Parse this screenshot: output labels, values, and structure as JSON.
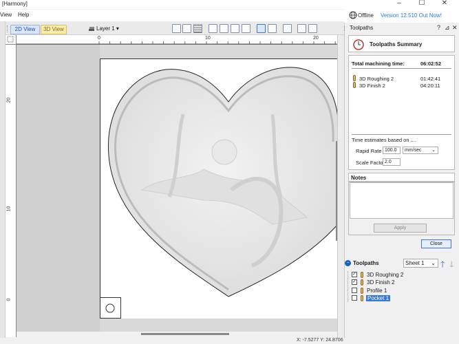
{
  "window": {
    "title": "[Harmony]",
    "minimize": "–",
    "maximize": "☐",
    "close": "✕"
  },
  "menu": [
    {
      "label": "View"
    },
    {
      "label": "Help"
    }
  ],
  "header_right": {
    "offline_label": "Offline",
    "version_label": "Version 12.510 Out Now!"
  },
  "toolbar": {
    "tab_2d": "2D View",
    "tab_3d": "3D View",
    "layer_label": "Layer 1"
  },
  "rulers": {
    "top_labels": [
      "0",
      "10",
      "20"
    ],
    "left_labels": [
      "20",
      "10",
      "0"
    ]
  },
  "panel": {
    "title": "Toolpaths",
    "summary_title": "Toolpaths Summary",
    "total_label": "Total machining time:",
    "total_value": "06:02:52",
    "toolpaths": [
      {
        "name": "3D Roughing 2",
        "time": "01:42:41"
      },
      {
        "name": "3D Finish 2",
        "time": "04:20:11"
      }
    ],
    "estimates_label": "Time estimates based on ....",
    "rapid_rate_label": "Rapid Rate",
    "rapid_rate_value": "100.0",
    "rapid_unit": "mm/sec",
    "scale_factor_label": "Scale Factor",
    "scale_factor_value": "2.0",
    "notes_label": "Notes",
    "apply_label": "Apply",
    "close_label": "Close"
  },
  "toolpaths_list": {
    "title": "Toolpaths",
    "sheet_value": "Sheet 1",
    "items": [
      {
        "name": "3D Roughing 2",
        "checked": true
      },
      {
        "name": "3D Finish 2",
        "checked": true
      },
      {
        "name": "Profile 1",
        "checked": false
      },
      {
        "name": "Pocket 1",
        "checked": false,
        "selected": true
      }
    ]
  },
  "status": {
    "coords": "X: -7.5277 Y: 24.8706"
  }
}
